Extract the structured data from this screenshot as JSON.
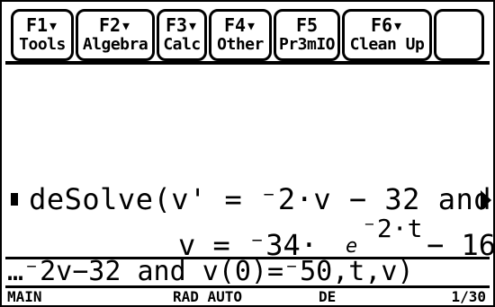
{
  "toolbar": {
    "tools": [
      {
        "key": "F1▾",
        "label": "Tools"
      },
      {
        "key": "F2▾",
        "label": "Algebra"
      },
      {
        "key": "F3▾",
        "label": "Calc"
      },
      {
        "key": "F4▾",
        "label": "Other"
      },
      {
        "key": "F5",
        "label": "Pr3mIO"
      },
      {
        "key": "F6▾",
        "label": "Clean Up"
      }
    ]
  },
  "history": {
    "entry": "deSolve(v' = ⁻2·v − 32  and",
    "result": {
      "lhs": "v =",
      "coef": "⁻34·",
      "base": "e",
      "exponent": "⁻2·t",
      "tail": "− 16"
    }
  },
  "entry_line": {
    "text": "…⁻2v−32  and  v(0)=⁻50,t,v)"
  },
  "status": {
    "mode": "MAIN",
    "angle": "RAD AUTO",
    "graph": "DE",
    "history_count": "1/30"
  }
}
